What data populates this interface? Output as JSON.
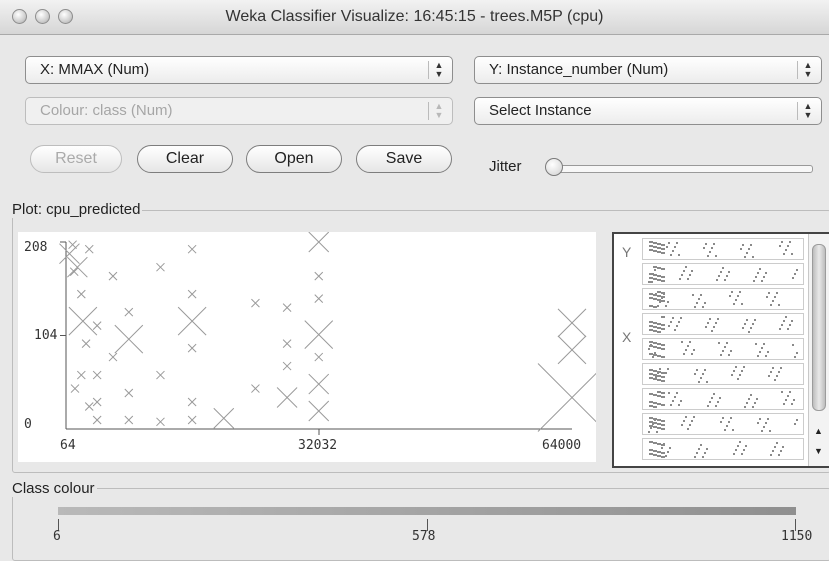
{
  "window": {
    "title": "Weka Classifier Visualize: 16:45:15 - trees.M5P (cpu)"
  },
  "controls": {
    "x_axis": "X: MMAX (Num)",
    "y_axis": "Y: Instance_number (Num)",
    "colour": "Colour: class (Num)",
    "select_instance": "Select Instance",
    "reset": "Reset",
    "clear": "Clear",
    "open": "Open",
    "save": "Save",
    "jitter": "Jitter",
    "jitter_value": 0
  },
  "plot": {
    "title": "Plot: cpu_predicted"
  },
  "matrix": {
    "y_label": "Y",
    "x_label": "X"
  },
  "class_colour": {
    "title": "Class colour",
    "ticks": [
      "6",
      "578",
      "1150"
    ]
  },
  "chart_data": {
    "type": "scatter",
    "x_ticks": [
      "64",
      "32032",
      "64000"
    ],
    "y_ticks": [
      "0",
      "104",
      "208"
    ],
    "xlim": [
      64,
      64000
    ],
    "ylim": [
      0,
      208
    ],
    "marker": "x",
    "color": "#999999",
    "points": [
      {
        "x": 500,
        "y": 195,
        "s": 10
      },
      {
        "x": 900,
        "y": 205,
        "s": 4
      },
      {
        "x": 1100,
        "y": 175,
        "s": 4
      },
      {
        "x": 1500,
        "y": 180,
        "s": 10
      },
      {
        "x": 2000,
        "y": 150,
        "s": 4
      },
      {
        "x": 2200,
        "y": 120,
        "s": 14
      },
      {
        "x": 2600,
        "y": 95,
        "s": 4
      },
      {
        "x": 3000,
        "y": 200,
        "s": 4
      },
      {
        "x": 4000,
        "y": 115,
        "s": 4
      },
      {
        "x": 4000,
        "y": 60,
        "s": 4
      },
      {
        "x": 4000,
        "y": 30,
        "s": 4
      },
      {
        "x": 4000,
        "y": 10,
        "s": 4
      },
      {
        "x": 8000,
        "y": 130,
        "s": 4
      },
      {
        "x": 8000,
        "y": 100,
        "s": 14
      },
      {
        "x": 8000,
        "y": 40,
        "s": 4
      },
      {
        "x": 8000,
        "y": 10,
        "s": 4
      },
      {
        "x": 2000,
        "y": 60,
        "s": 4
      },
      {
        "x": 1200,
        "y": 45,
        "s": 4
      },
      {
        "x": 3000,
        "y": 25,
        "s": 4
      },
      {
        "x": 6000,
        "y": 170,
        "s": 4
      },
      {
        "x": 6000,
        "y": 80,
        "s": 4
      },
      {
        "x": 12000,
        "y": 180,
        "s": 4
      },
      {
        "x": 12000,
        "y": 60,
        "s": 4
      },
      {
        "x": 12000,
        "y": 8,
        "s": 4
      },
      {
        "x": 16000,
        "y": 200,
        "s": 4
      },
      {
        "x": 16000,
        "y": 150,
        "s": 4
      },
      {
        "x": 16000,
        "y": 120,
        "s": 14
      },
      {
        "x": 16000,
        "y": 90,
        "s": 4
      },
      {
        "x": 16000,
        "y": 30,
        "s": 4
      },
      {
        "x": 16000,
        "y": 10,
        "s": 4
      },
      {
        "x": 20000,
        "y": 12,
        "s": 10
      },
      {
        "x": 24000,
        "y": 140,
        "s": 4
      },
      {
        "x": 24000,
        "y": 45,
        "s": 4
      },
      {
        "x": 28000,
        "y": 135,
        "s": 4
      },
      {
        "x": 28000,
        "y": 95,
        "s": 4
      },
      {
        "x": 28000,
        "y": 70,
        "s": 4
      },
      {
        "x": 28000,
        "y": 35,
        "s": 10
      },
      {
        "x": 32000,
        "y": 208,
        "s": 10
      },
      {
        "x": 32000,
        "y": 170,
        "s": 4
      },
      {
        "x": 32000,
        "y": 145,
        "s": 4
      },
      {
        "x": 32000,
        "y": 105,
        "s": 14
      },
      {
        "x": 32000,
        "y": 80,
        "s": 4
      },
      {
        "x": 32000,
        "y": 50,
        "s": 10
      },
      {
        "x": 32000,
        "y": 20,
        "s": 10
      },
      {
        "x": 64000,
        "y": 118,
        "s": 14
      },
      {
        "x": 64000,
        "y": 88,
        "s": 14
      },
      {
        "x": 64000,
        "y": 35,
        "s": 34
      }
    ]
  }
}
